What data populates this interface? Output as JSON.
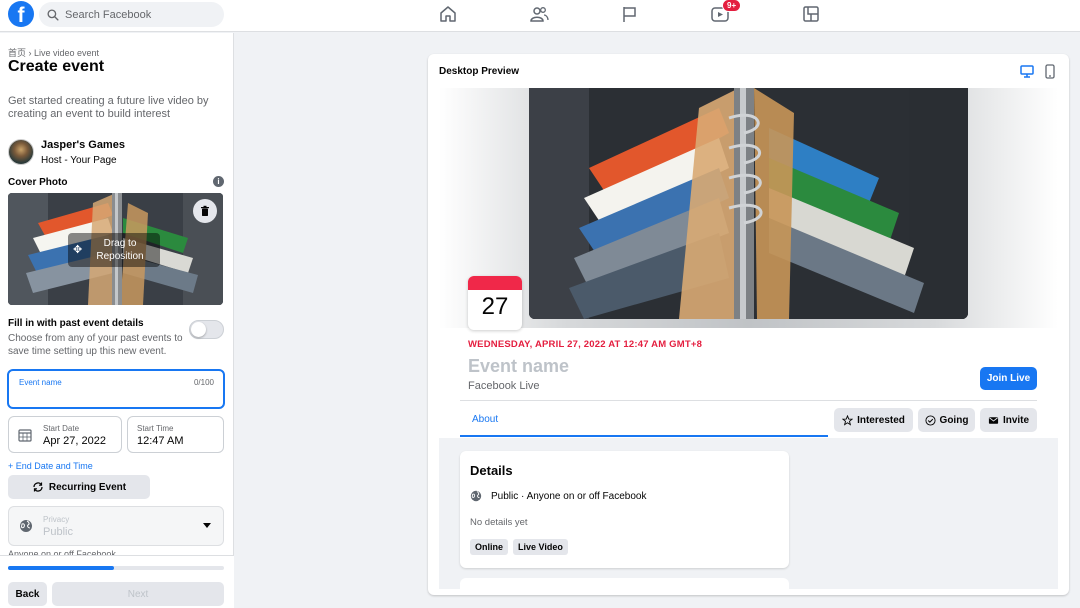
{
  "header": {
    "logo_letter": "f",
    "search_placeholder": "Search Facebook",
    "notification_badge": "9+",
    "nav_icons": [
      "home-icon",
      "friends-icon",
      "pages-flag-icon",
      "watch-icon",
      "gaming-icon"
    ]
  },
  "left": {
    "breadcrumb": "首页 › Live video event",
    "title": "Create event",
    "intro": "Get started creating a future live video by creating an event to build interest",
    "host_name": "Jasper's Games",
    "host_role": "Host - Your Page",
    "cover_label": "Cover Photo",
    "drag_hint_line1": "Drag to",
    "drag_hint_line2": "Reposition",
    "fill_title": "Fill in with past event details",
    "fill_desc": "Choose from any of your past events to save time setting up this new event.",
    "fill_toggle_on": false,
    "event_name_label": "Event name",
    "event_name_value": "",
    "event_name_count": "0/100",
    "start_date_label": "Start Date",
    "start_date_value": "Apr 27, 2022",
    "start_time_label": "Start Time",
    "start_time_value": "12:47 AM",
    "end_link": "+ End Date and Time",
    "recurring_label": "Recurring Event",
    "privacy_label": "Privacy",
    "privacy_value": "Public",
    "privacy_note": "Anyone on or off Facebook",
    "progress_fraction": 0.49,
    "back_label": "Back",
    "next_label": "Next"
  },
  "preview": {
    "title": "Desktop Preview",
    "day_number": "27",
    "date_line": "WEDNESDAY, APRIL 27, 2022 AT 12:47 AM GMT+8",
    "event_name_placeholder": "Event name",
    "subtitle": "Facebook Live",
    "join_label": "Join Live",
    "tab_about": "About",
    "interested_label": "Interested",
    "going_label": "Going",
    "invite_label": "Invite",
    "details_title": "Details",
    "details_privacy": "Public · Anyone on or off Facebook",
    "details_none": "No details yet",
    "chips": [
      "Online",
      "Live Video"
    ]
  },
  "colors": {
    "brand_blue": "#1877f2",
    "date_red": "#e41e3f",
    "background": "#f0f2f5"
  }
}
